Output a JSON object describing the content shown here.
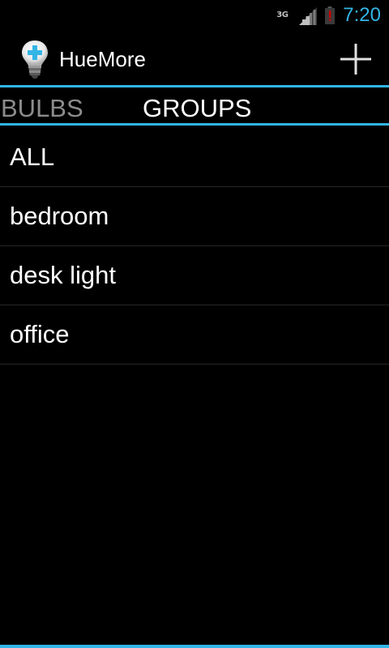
{
  "status_bar": {
    "network_type": "3G",
    "time": "7:20",
    "icons": [
      "signal-icon",
      "battery-icon"
    ]
  },
  "action_bar": {
    "title": "HueMore",
    "app_icon": "lightbulb-plus-icon",
    "add_icon": "plus-icon"
  },
  "tabs": [
    {
      "label": "BULBS",
      "selected": false
    },
    {
      "label": "GROUPS",
      "selected": true
    }
  ],
  "groups": [
    {
      "label": "ALL"
    },
    {
      "label": "bedroom"
    },
    {
      "label": "desk light"
    },
    {
      "label": "office"
    }
  ],
  "colors": {
    "accent": "#33b5e5",
    "background": "#000000",
    "inactive_tab": "#8c8c8c",
    "battery_alert": "#cc0000"
  }
}
